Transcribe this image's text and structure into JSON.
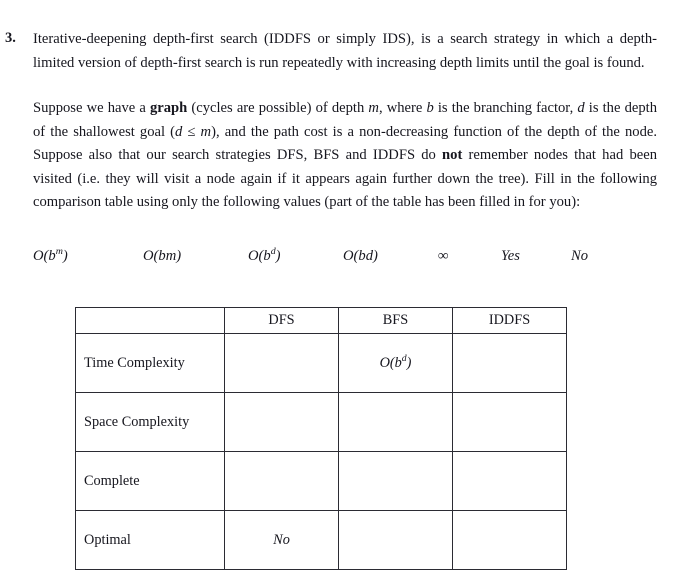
{
  "question": {
    "number": "3.",
    "paragraph_1": "Iterative-deepening depth-first search (IDDFS or simply IDS), is a search strategy in which a depth-limited version of depth-first search is run repeatedly with increasing depth limits until the goal is found.",
    "paragraph_2": {
      "part_1": "Suppose we have a ",
      "emphasis_1": "graph",
      "part_2": " (cycles are possible) of depth ",
      "italic_m": "m",
      "part_3": ", where ",
      "italic_b": "b",
      "part_4": " is the branching factor, ",
      "italic_d": "d",
      "part_5": " is the depth of the shallowest goal (",
      "condition": "d ≤ m",
      "part_6": "), and the path cost is a non-decreasing function of the depth of the node. Suppose also that our search strategies DFS, BFS and IDDFS do ",
      "emphasis_2": "not",
      "part_7": " remember nodes that had been visited (i.e. they will visit a node again if it appears again further down the tree). Fill in the following comparison table using only the following values (part of the table has been filled in for you):"
    }
  },
  "word_bank": [
    {
      "base": "O(b",
      "sup": "m",
      "tail": ")"
    },
    {
      "base": "O(bm)",
      "sup": "",
      "tail": ""
    },
    {
      "base": "O(b",
      "sup": "d",
      "tail": ")"
    },
    {
      "base": "O(bd)",
      "sup": "",
      "tail": ""
    },
    {
      "base": "∞",
      "sup": "",
      "tail": ""
    },
    {
      "base": "Yes",
      "sup": "",
      "tail": ""
    },
    {
      "base": "No",
      "sup": "",
      "tail": ""
    }
  ],
  "table": {
    "headers": [
      "",
      "DFS",
      "BFS",
      "IDDFS"
    ],
    "rows": [
      {
        "label": "Time Complexity",
        "cells": [
          {
            "base": "",
            "sup": "",
            "tail": ""
          },
          {
            "base": "O(b",
            "sup": "d",
            "tail": ")"
          },
          {
            "base": "",
            "sup": "",
            "tail": ""
          }
        ]
      },
      {
        "label": "Space Complexity",
        "cells": [
          {
            "base": "",
            "sup": "",
            "tail": ""
          },
          {
            "base": "",
            "sup": "",
            "tail": ""
          },
          {
            "base": "",
            "sup": "",
            "tail": ""
          }
        ]
      },
      {
        "label": "Complete",
        "cells": [
          {
            "base": "",
            "sup": "",
            "tail": ""
          },
          {
            "base": "",
            "sup": "",
            "tail": ""
          },
          {
            "base": "",
            "sup": "",
            "tail": ""
          }
        ]
      },
      {
        "label": "Optimal",
        "cells": [
          {
            "base": "No",
            "sup": "",
            "tail": ""
          },
          {
            "base": "",
            "sup": "",
            "tail": ""
          },
          {
            "base": "",
            "sup": "",
            "tail": ""
          }
        ]
      }
    ]
  }
}
